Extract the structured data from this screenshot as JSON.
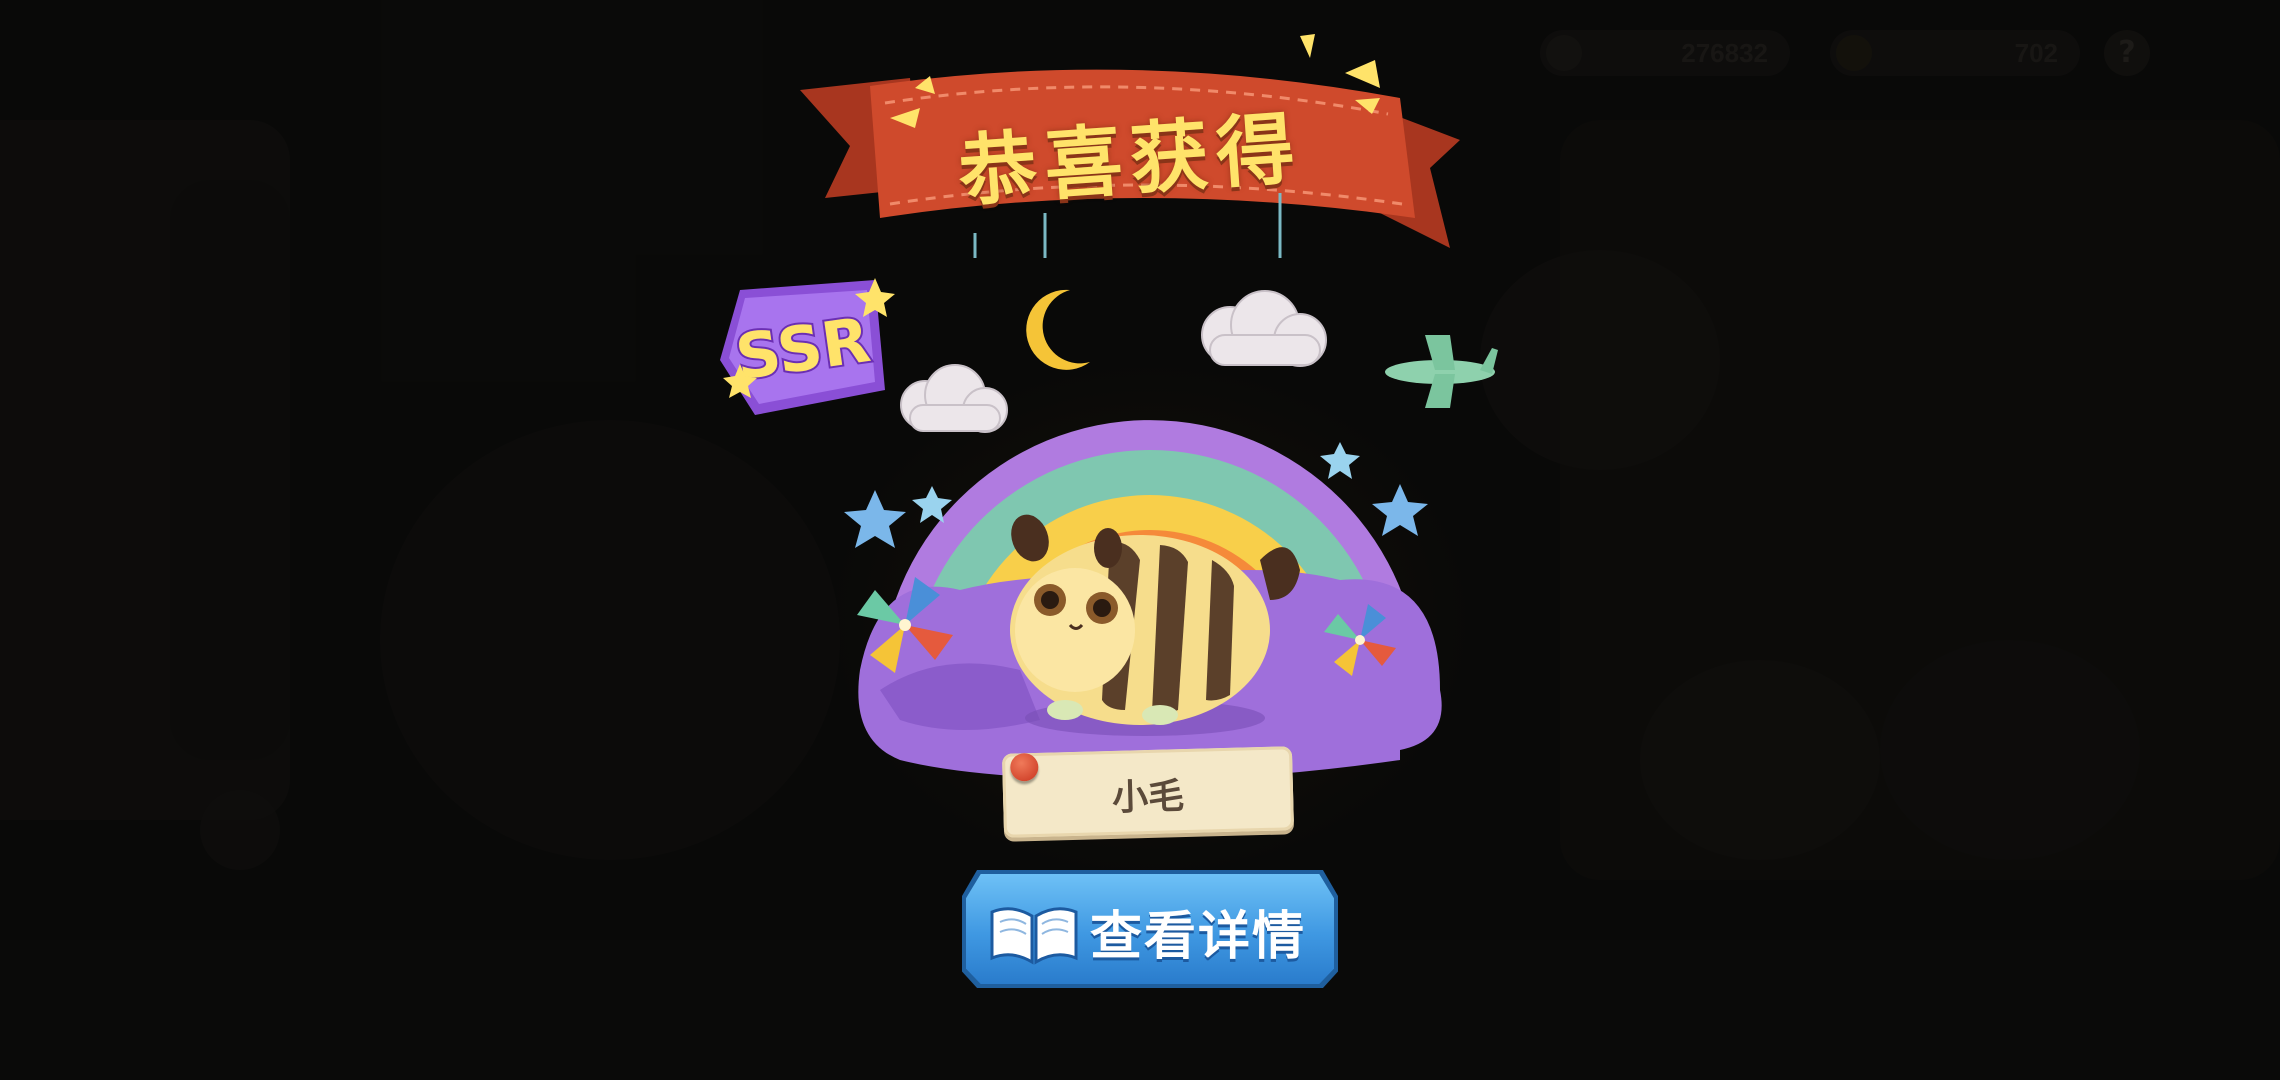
{
  "banner": {
    "title": "恭喜获得"
  },
  "reward": {
    "rarity": "SSR",
    "name": "小毛"
  },
  "actions": {
    "view_details": "查看详情"
  },
  "topbar": {
    "currency_1": "276832",
    "currency_2": "702",
    "help": "?"
  },
  "colors": {
    "banner_red": "#cf4a2c",
    "title_yellow": "#ffe36a",
    "ssr_purple": "#8a4fd6",
    "button_blue": "#3f98e2",
    "rainbow": [
      "#b07be0",
      "#7fc7b0",
      "#f8cf4a",
      "#f58a3a"
    ]
  }
}
